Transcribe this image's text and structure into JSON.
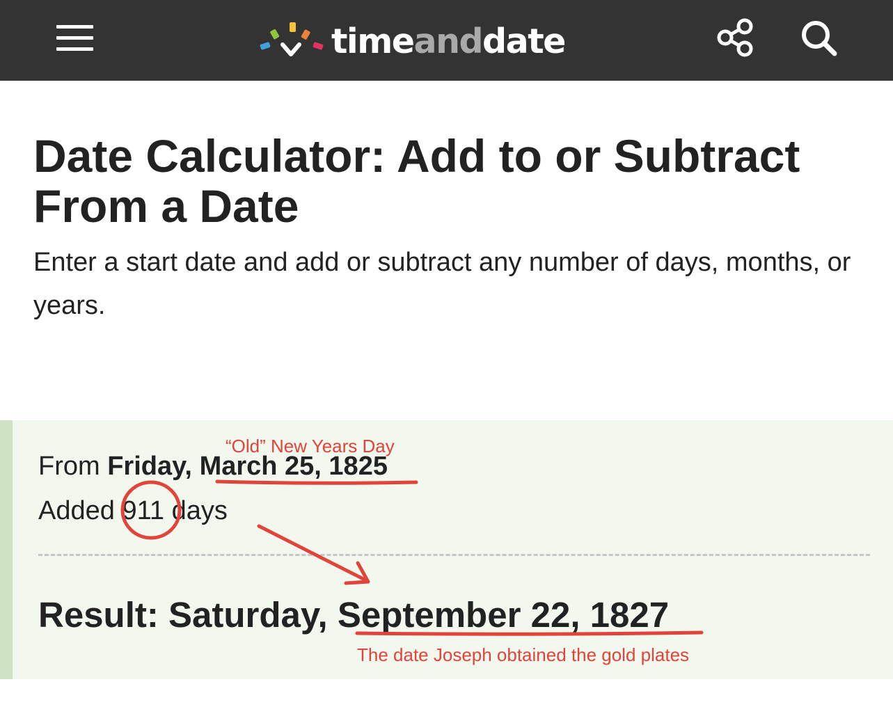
{
  "header": {
    "logo_text": {
      "part1": "time",
      "part2": "and",
      "part3": "date"
    },
    "icons": {
      "menu": "hamburger-menu-icon",
      "share": "share-icon",
      "search": "search-icon"
    },
    "colors": {
      "bar": "#333333",
      "logo_text": "#ffffff",
      "logo_and": "#a9a9a9"
    }
  },
  "main": {
    "title": "Date Calculator: Add to or Subtract From a Date",
    "intro": "Enter a start date and add or subtract any number of days, months, or years."
  },
  "result": {
    "from_prefix": "From",
    "from_weekday": "Friday,",
    "from_date": "March 25, 1825",
    "added_prefix": "Added",
    "added_number": "911",
    "added_unit": "days",
    "result_prefix": "Result: Saturday,",
    "result_date": "September 22, 1827",
    "colors": {
      "background": "#f3f8ef",
      "left_bar": "#cfe3c4"
    }
  },
  "annotations": {
    "top_note": "“Old” New Years Day",
    "bottom_note": "The date Joseph obtained the gold plates",
    "color": "#e0443a"
  }
}
